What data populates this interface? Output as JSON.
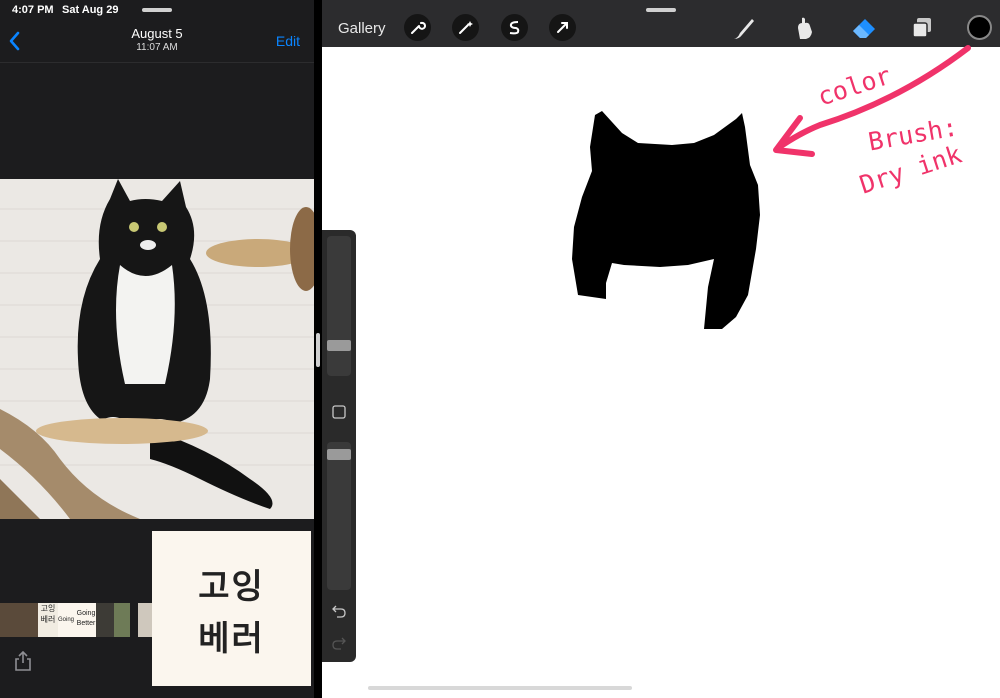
{
  "status_bar": {
    "time": "4:07 PM",
    "date": "Sat Aug 29"
  },
  "photos_app": {
    "nav": {
      "back_icon": "chevron-left-icon",
      "title": "August 5",
      "subtitle": "11:07 AM",
      "edit_label": "Edit"
    },
    "text_thumbnail": {
      "line1": "고잉",
      "line2": "베러"
    },
    "filmstrip_labels": [
      "고잉 베러",
      "Going Better",
      "Going Better"
    ],
    "share_icon": "share-icon"
  },
  "procreate": {
    "gallery_label": "Gallery",
    "left_tools": [
      "wrench-icon",
      "magic-wand-icon",
      "selection-s-icon",
      "transform-arrow-icon"
    ],
    "right_tools": [
      "brush-icon",
      "smudge-icon",
      "eraser-icon",
      "layers-icon"
    ],
    "color_well": "#000000",
    "side_tools": [
      "brush-size-slider",
      "modify-square-button",
      "opacity-slider",
      "undo-icon",
      "redo-icon"
    ]
  },
  "annotations": {
    "color_label": "color",
    "brush_label": "Brush:",
    "brush_value": "Dry ink",
    "accent": "#f0336a"
  },
  "colors": {
    "toolbar_bg": "#2c2c2e",
    "selected_tool": "#1e8fff",
    "link_blue": "#0a84ff"
  }
}
